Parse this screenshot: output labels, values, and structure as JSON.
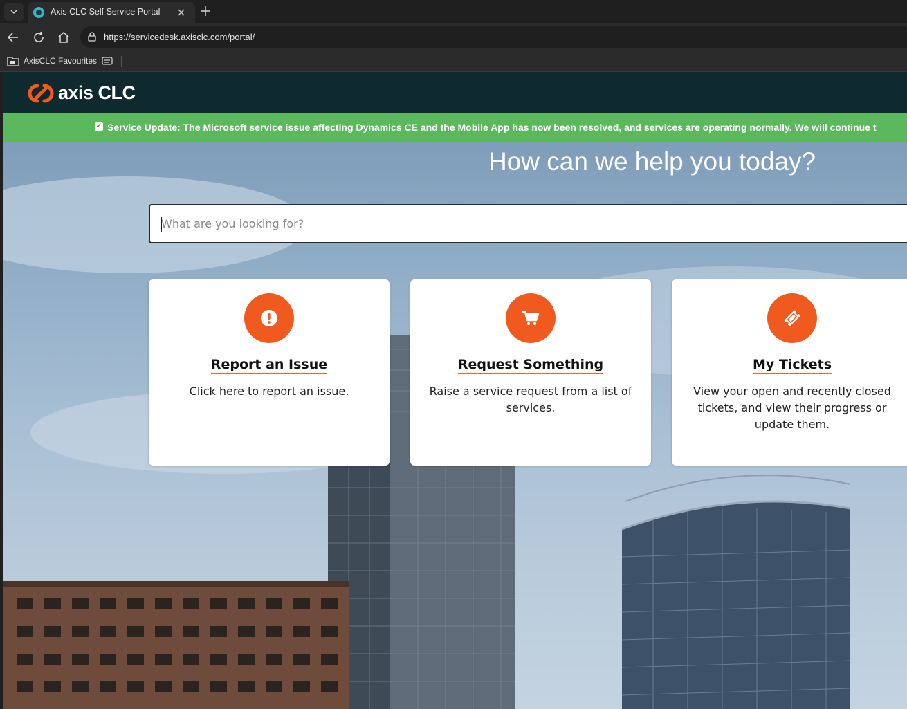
{
  "browser": {
    "tab_title": "Axis CLC Self Service Portal",
    "url": "https://servicedesk.axisclc.com/portal/",
    "bookmark_folder": "AxisCLC Favourites"
  },
  "site": {
    "logo_text": "axis CLC",
    "banner_text": "Service Update: The Microsoft service issue affecting Dynamics CE and the Mobile App has now been resolved, and services are operating normally. We will continue t",
    "hero_title": "How can we help you today?",
    "search_placeholder": "What are you looking for?"
  },
  "cards": [
    {
      "title": "Report an Issue",
      "description": "Click here to report an issue.",
      "icon": "exclamation-icon"
    },
    {
      "title": "Request Something",
      "description": "Raise a service request from a list of services.",
      "icon": "cart-icon"
    },
    {
      "title": "My Tickets",
      "description": "View your open and recently closed tickets, and view their progress or update them.",
      "icon": "ticket-icon"
    }
  ],
  "colors": {
    "header_bg": "#0f2a2e",
    "banner_bg": "#5cb85c",
    "accent": "#f15a1f"
  }
}
